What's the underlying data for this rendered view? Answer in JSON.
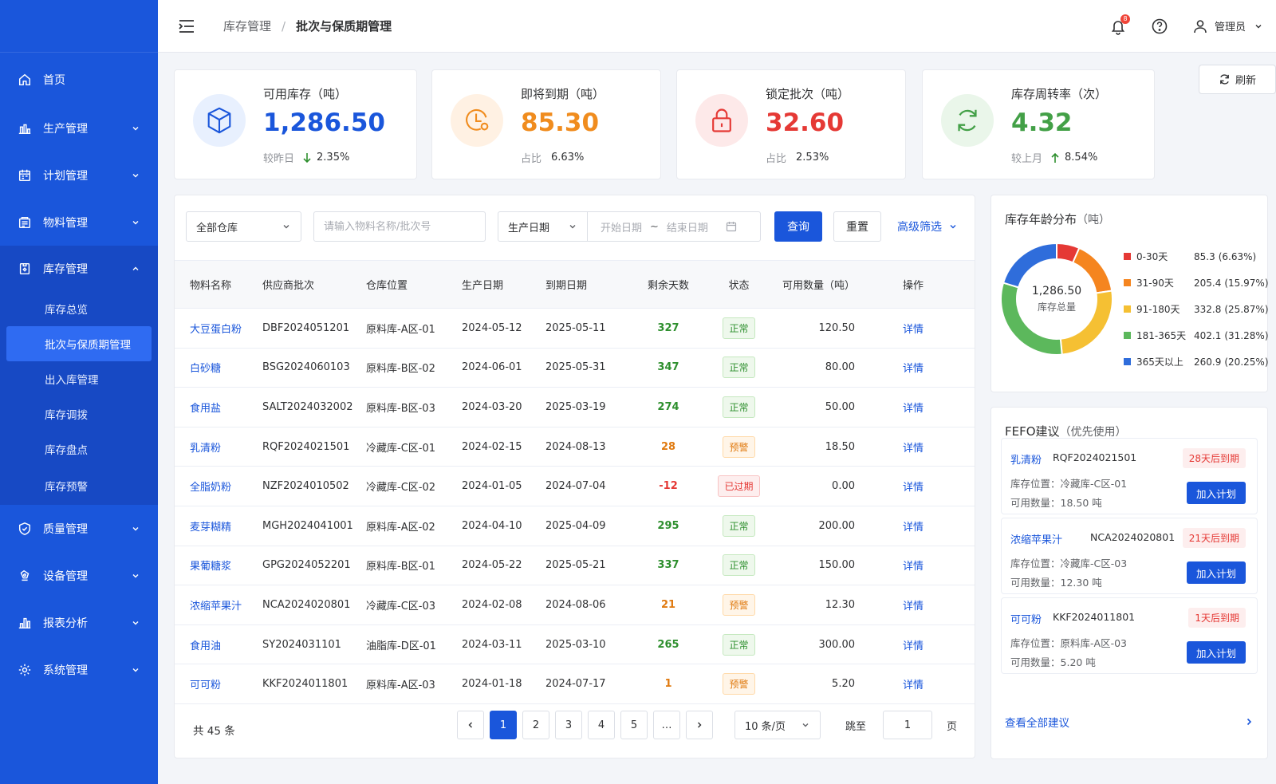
{
  "colors": {
    "primary": "#1a56db",
    "success": "#2e8f2e",
    "warning": "#e07a10",
    "danger": "#e53935"
  },
  "sidebar": {
    "items": [
      {
        "label": "首页",
        "icon": "home-icon"
      },
      {
        "label": "生产管理",
        "icon": "factory-icon"
      },
      {
        "label": "计划管理",
        "icon": "calendar-icon"
      },
      {
        "label": "物料管理",
        "icon": "material-icon"
      },
      {
        "label": "库存管理",
        "icon": "inventory-icon"
      },
      {
        "label": "质量管理",
        "icon": "shield-icon"
      },
      {
        "label": "设备管理",
        "icon": "device-icon"
      },
      {
        "label": "报表分析",
        "icon": "chart-icon"
      },
      {
        "label": "系统管理",
        "icon": "gear-icon"
      }
    ],
    "sub_items": [
      {
        "label": "库存总览"
      },
      {
        "label": "批次与保质期管理"
      },
      {
        "label": "出入库管理"
      },
      {
        "label": "库存调拨"
      },
      {
        "label": "库存盘点"
      },
      {
        "label": "库存预警"
      }
    ]
  },
  "header": {
    "breadcrumb": [
      "库存管理",
      "批次与保质期管理"
    ],
    "separator": "/",
    "notify_count": "8",
    "user": "管理员"
  },
  "stats": [
    {
      "title": "可用库存（吨）",
      "value": "1,286.50",
      "sub_label": "较昨日",
      "sub_value": "2.35%",
      "trend": "down",
      "color": "#1a56db",
      "icon": "cube-icon"
    },
    {
      "title": "即将到期（吨）",
      "value": "85.30",
      "sub_label": "占比",
      "sub_value": "6.63%",
      "color": "#f08c1e",
      "icon": "clock-icon"
    },
    {
      "title": "锁定批次（吨）",
      "value": "32.60",
      "sub_label": "占比",
      "sub_value": "2.53%",
      "color": "#e53935",
      "icon": "lock-icon"
    },
    {
      "title": "库存周转率（次）",
      "value": "4.32",
      "sub_label": "较上月",
      "sub_value": "8.54%",
      "trend": "up",
      "color": "#43a047",
      "icon": "refresh-icon"
    }
  ],
  "refresh_label": "刷新",
  "filters": {
    "warehouse": "全部仓库",
    "search_placeholder": "请输入物料名称/批次号",
    "date_type": "生产日期",
    "start_placeholder": "开始日期",
    "tilde": "~",
    "end_placeholder": "结束日期",
    "query": "查询",
    "reset": "重置",
    "advanced": "高级筛选"
  },
  "table": {
    "columns": [
      "物料名称",
      "供应商批次",
      "仓库位置",
      "生产日期",
      "到期日期",
      "剩余天数",
      "状态",
      "可用数量（吨）",
      "操作"
    ],
    "action": "详情",
    "rows": [
      {
        "name": "大豆蛋白粉",
        "batch": "DBF2024051201",
        "loc": "原料库-A区-01",
        "prod": "2024-05-12",
        "exp": "2025-05-11",
        "days": "327",
        "status": "正常",
        "level": "ok",
        "qty": "120.50"
      },
      {
        "name": "白砂糖",
        "batch": "BSG2024060103",
        "loc": "原料库-B区-02",
        "prod": "2024-06-01",
        "exp": "2025-05-31",
        "days": "347",
        "status": "正常",
        "level": "ok",
        "qty": "80.00"
      },
      {
        "name": "食用盐",
        "batch": "SALT2024032002",
        "loc": "原料库-B区-03",
        "prod": "2024-03-20",
        "exp": "2025-03-19",
        "days": "274",
        "status": "正常",
        "level": "ok",
        "qty": "50.00"
      },
      {
        "name": "乳清粉",
        "batch": "RQF2024021501",
        "loc": "冷藏库-C区-01",
        "prod": "2024-02-15",
        "exp": "2024-08-13",
        "days": "28",
        "status": "预警",
        "level": "warn",
        "qty": "18.50"
      },
      {
        "name": "全脂奶粉",
        "batch": "NZF2024010502",
        "loc": "冷藏库-C区-02",
        "prod": "2024-01-05",
        "exp": "2024-07-04",
        "days": "-12",
        "status": "已过期",
        "level": "exp",
        "qty": "0.00"
      },
      {
        "name": "麦芽糊精",
        "batch": "MGH2024041001",
        "loc": "原料库-A区-02",
        "prod": "2024-04-10",
        "exp": "2025-04-09",
        "days": "295",
        "status": "正常",
        "level": "ok",
        "qty": "200.00"
      },
      {
        "name": "果葡糖浆",
        "batch": "GPG2024052201",
        "loc": "原料库-B区-01",
        "prod": "2024-05-22",
        "exp": "2025-05-21",
        "days": "337",
        "status": "正常",
        "level": "ok",
        "qty": "150.00"
      },
      {
        "name": "浓缩苹果汁",
        "batch": "NCA2024020801",
        "loc": "冷藏库-C区-03",
        "prod": "2024-02-08",
        "exp": "2024-08-06",
        "days": "21",
        "status": "预警",
        "level": "warn",
        "qty": "12.30"
      },
      {
        "name": "食用油",
        "batch": "SY2024031101",
        "loc": "油脂库-D区-01",
        "prod": "2024-03-11",
        "exp": "2025-03-10",
        "days": "265",
        "status": "正常",
        "level": "ok",
        "qty": "300.00"
      },
      {
        "name": "可可粉",
        "batch": "KKF2024011801",
        "loc": "原料库-A区-03",
        "prod": "2024-01-18",
        "exp": "2024-07-17",
        "days": "1",
        "status": "预警",
        "level": "warn",
        "qty": "5.20"
      }
    ]
  },
  "pagination": {
    "total": "共 45 条",
    "pages": [
      "1",
      "2",
      "3",
      "4",
      "5",
      "…"
    ],
    "current": "1",
    "page_size": "10 条/页",
    "jump_label": "跳至",
    "jump_value": "1",
    "page_suffix": "页"
  },
  "age_chart": {
    "title": "库存年龄分布",
    "unit": "（吨）",
    "center_value": "1,286.50",
    "center_label": "库存总量",
    "chart_data": {
      "type": "pie",
      "title": "库存年龄分布（吨）",
      "categories": [
        "0-30天",
        "31-90天",
        "91-180天",
        "181-365天",
        "365天以上"
      ],
      "values": [
        85.3,
        205.4,
        332.8,
        402.1,
        260.9
      ],
      "percents": [
        "6.63%",
        "15.97%",
        "25.87%",
        "31.28%",
        "20.25%"
      ],
      "colors": [
        "#e53935",
        "#f5851f",
        "#f5c033",
        "#5cb85c",
        "#2f6ddb"
      ],
      "legend_position": "right"
    }
  },
  "fefo": {
    "title": "FEFO建议",
    "note": "（优先使用）",
    "loc_label": "库存位置：",
    "qty_label": "可用数量：",
    "button": "加入计划",
    "view_all": "查看全部建议",
    "items": [
      {
        "name": "乳清粉",
        "batch": "RQF2024021501",
        "expire": "28天后到期",
        "loc": "冷藏库-C区-01",
        "qty": "18.50 吨"
      },
      {
        "name": "浓缩苹果汁",
        "batch": "NCA2024020801",
        "expire": "21天后到期",
        "loc": "冷藏库-C区-03",
        "qty": "12.30 吨"
      },
      {
        "name": "可可粉",
        "batch": "KKF2024011801",
        "expire": "1天后到期",
        "loc": "原料库-A区-03",
        "qty": "5.20 吨"
      }
    ]
  }
}
